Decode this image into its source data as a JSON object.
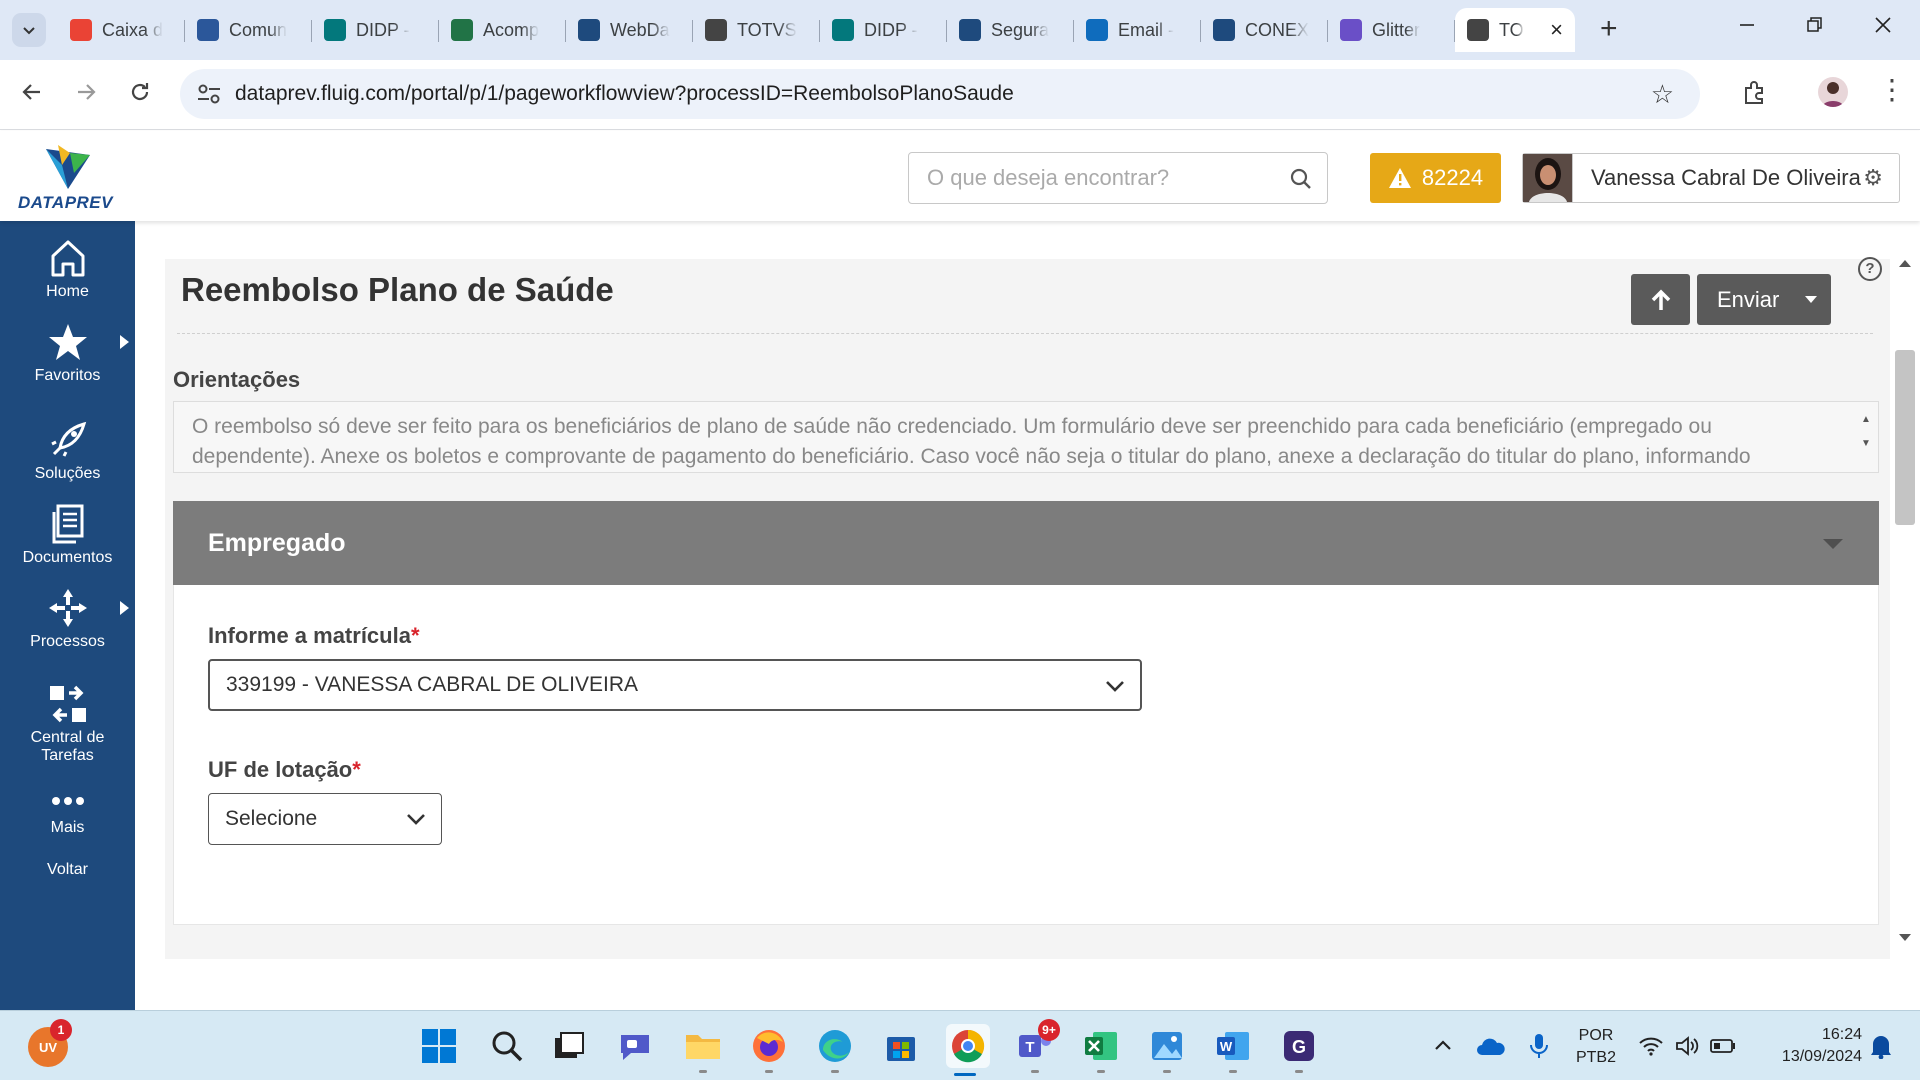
{
  "browser": {
    "tabs": [
      {
        "label": "Caixa d",
        "icon": "gmail-icon",
        "color": "#ea4335"
      },
      {
        "label": "Comun",
        "icon": "word-icon",
        "color": "#2b579a"
      },
      {
        "label": "DIDP -",
        "icon": "sharepoint-icon",
        "color": "#03787c"
      },
      {
        "label": "Acomp",
        "icon": "excel-icon",
        "color": "#217346"
      },
      {
        "label": "WebDa",
        "icon": "dataprev-icon",
        "color": "#1e4a7d"
      },
      {
        "label": "TOTVS",
        "icon": "totvs-icon",
        "color": "#444444"
      },
      {
        "label": "DIDP -",
        "icon": "sharepoint-icon",
        "color": "#03787c"
      },
      {
        "label": "Segura",
        "icon": "dataprev-icon",
        "color": "#1e4a7d"
      },
      {
        "label": "Email -",
        "icon": "outlook-icon",
        "color": "#0f6cbd"
      },
      {
        "label": "CONEX",
        "icon": "dataprev-icon",
        "color": "#1e4a7d"
      },
      {
        "label": "Glitter",
        "icon": "glitter-icon",
        "color": "#6a4fc7"
      },
      {
        "label": "TO",
        "icon": "totvs-icon",
        "color": "#444444"
      }
    ],
    "new_tab": "+",
    "url": "dataprev.fluig.com/portal/p/1/pageworkflowview?processID=ReembolsoPlanoSaude"
  },
  "header": {
    "logo_text": "DATAPREV",
    "search_placeholder": "O que deseja encontrar?",
    "alert_count": "82224",
    "user_name": "Vanessa Cabral De Oliveira",
    "alert_color": "#e6a817"
  },
  "sidebar": {
    "color": "#1e4a7d",
    "items": [
      {
        "label": "Home",
        "icon": "home-icon"
      },
      {
        "label": "Favoritos",
        "icon": "star-icon"
      },
      {
        "label": "Soluções",
        "icon": "rocket-icon"
      },
      {
        "label": "Documentos",
        "icon": "documents-icon"
      },
      {
        "label": "Processos",
        "icon": "processes-icon"
      },
      {
        "label": "Central de Tarefas",
        "icon": "tasks-icon"
      },
      {
        "label": "Mais",
        "icon": "more-icon"
      },
      {
        "label": "Voltar",
        "icon": ""
      }
    ]
  },
  "page": {
    "title": "Reembolso Plano de Saúde",
    "send_label": "Enviar",
    "help": "?",
    "orientacoes_label": "Orientações",
    "orientacoes_text": "O reembolso só deve ser feito para os beneficiários de plano de saúde não credenciado. Um formulário deve ser preenchido para cada beneficiário (empregado ou dependente). Anexe os boletos e comprovante de pagamento do beneficiário. Caso você não seja o titular do plano, anexe a declaração do titular do plano, informando",
    "panel_title": "Empregado",
    "matricula_label": "Informe a matrícula",
    "matricula_value": "339199 - VANESSA CABRAL DE OLIVEIRA",
    "uf_label": "UF de lotação",
    "uf_value": "Selecione",
    "required_mark": "*"
  },
  "taskbar": {
    "user_initials": "UV",
    "user_badge": "1",
    "teams_badge": "9+",
    "lang_top": "POR",
    "lang_bottom": "PTB2",
    "time": "16:24",
    "date": "13/09/2024"
  }
}
